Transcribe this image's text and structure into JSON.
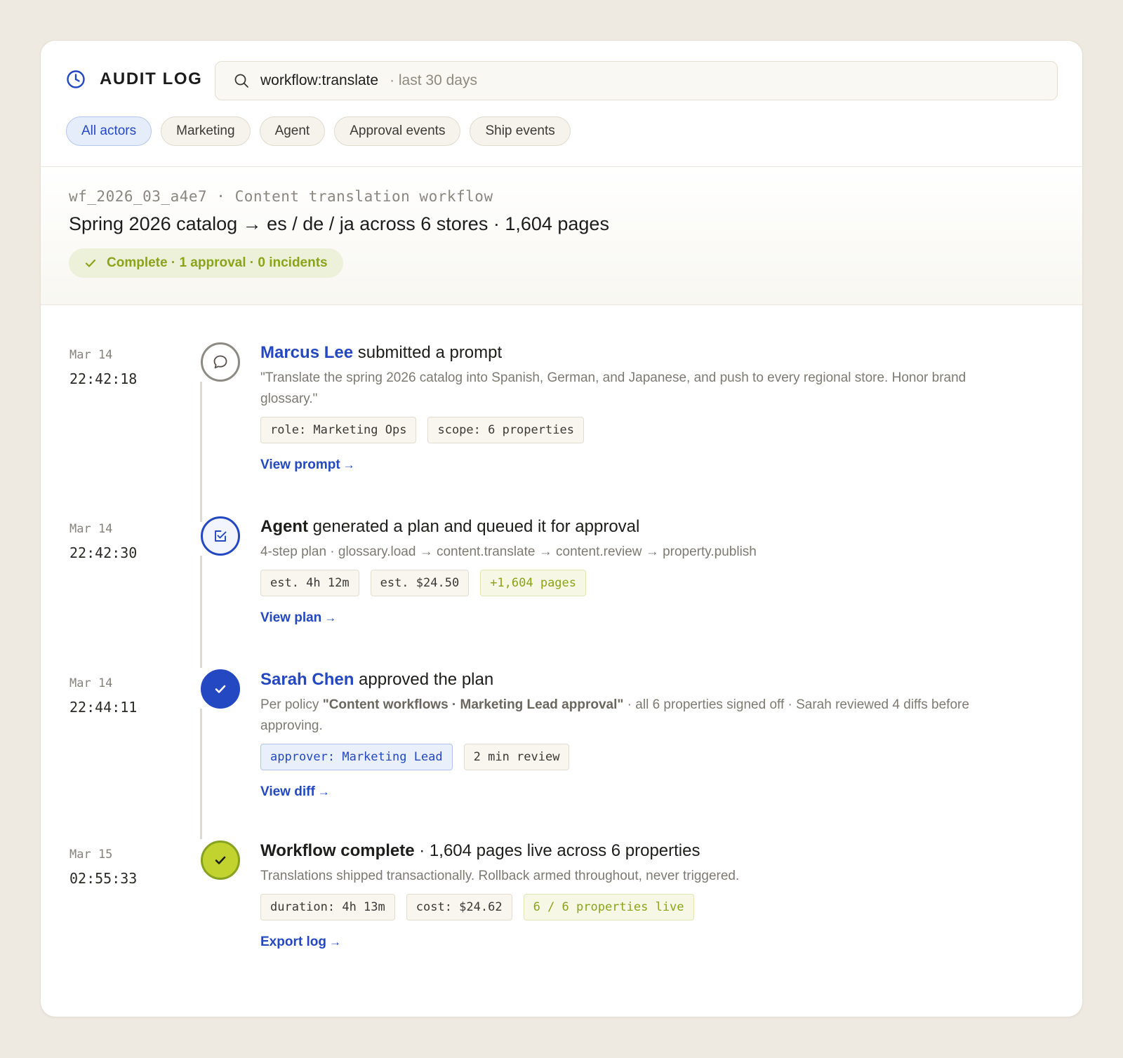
{
  "header": {
    "title": "AUDIT LOG",
    "search": {
      "query": "workflow:translate",
      "scope": "· last 30 days"
    },
    "filters": [
      "All actors",
      "Marketing",
      "Agent",
      "Approval events",
      "Ship events"
    ],
    "active_filter": "All actors"
  },
  "summary": {
    "workflow_id": "wf_2026_03_a4e7 · Content translation workflow",
    "title": "Spring 2026 catalog → es / de / ja across 6 stores · 1,604 pages",
    "status": "Complete · 1 approval · 0 incidents"
  },
  "events": [
    {
      "date": "Mar 14",
      "time": "22:42:18",
      "actor": "Marcus Lee",
      "action": " submitted a prompt",
      "desc": "\"Translate the spring 2026 catalog into Spanish, German, and Japanese, and push to every regional store. Honor brand glossary.\"",
      "tags": [
        "role: Marketing Ops",
        "scope: 6 properties"
      ],
      "link": "View prompt",
      "arrow": "→"
    },
    {
      "date": "Mar 14",
      "time": "22:42:30",
      "actor": "Agent",
      "action": " generated a plan and queued it for approval",
      "desc": "4-step plan · glossary.load → content.translate → content.review → property.publish",
      "tags": [
        "est. 4h 12m",
        "est. $24.50",
        "+1,604 pages"
      ],
      "link": "View plan",
      "arrow": "→"
    },
    {
      "date": "Mar 14",
      "time": "22:44:11",
      "actor": "Sarah Chen",
      "action": " approved the plan",
      "desc_prefix": "Per policy ",
      "desc_bold": "\"Content workflows · Marketing Lead approval\"",
      "desc_suffix": " · all 6 properties signed off · Sarah reviewed 4 diffs before approving.",
      "tags": [
        "approver: Marketing Lead",
        "2 min review"
      ],
      "link": "View diff",
      "arrow": "→"
    },
    {
      "date": "Mar 15",
      "time": "02:55:33",
      "actor": "Workflow complete",
      "action": " · 1,604 pages live across 6 properties",
      "desc": "Translations shipped transactionally. Rollback armed throughout, never triggered.",
      "tags": [
        "duration: 4h 13m",
        "cost: $24.62",
        "6 / 6 properties live"
      ],
      "link": "Export log",
      "arrow": "→"
    }
  ],
  "colors": {
    "accent": "#2348c2",
    "success": "#8aa319",
    "background": "#efeae1"
  },
  "icons": [
    "clock-icon",
    "search-icon",
    "check-icon",
    "chat-bubble-icon",
    "checkbox-icon"
  ]
}
